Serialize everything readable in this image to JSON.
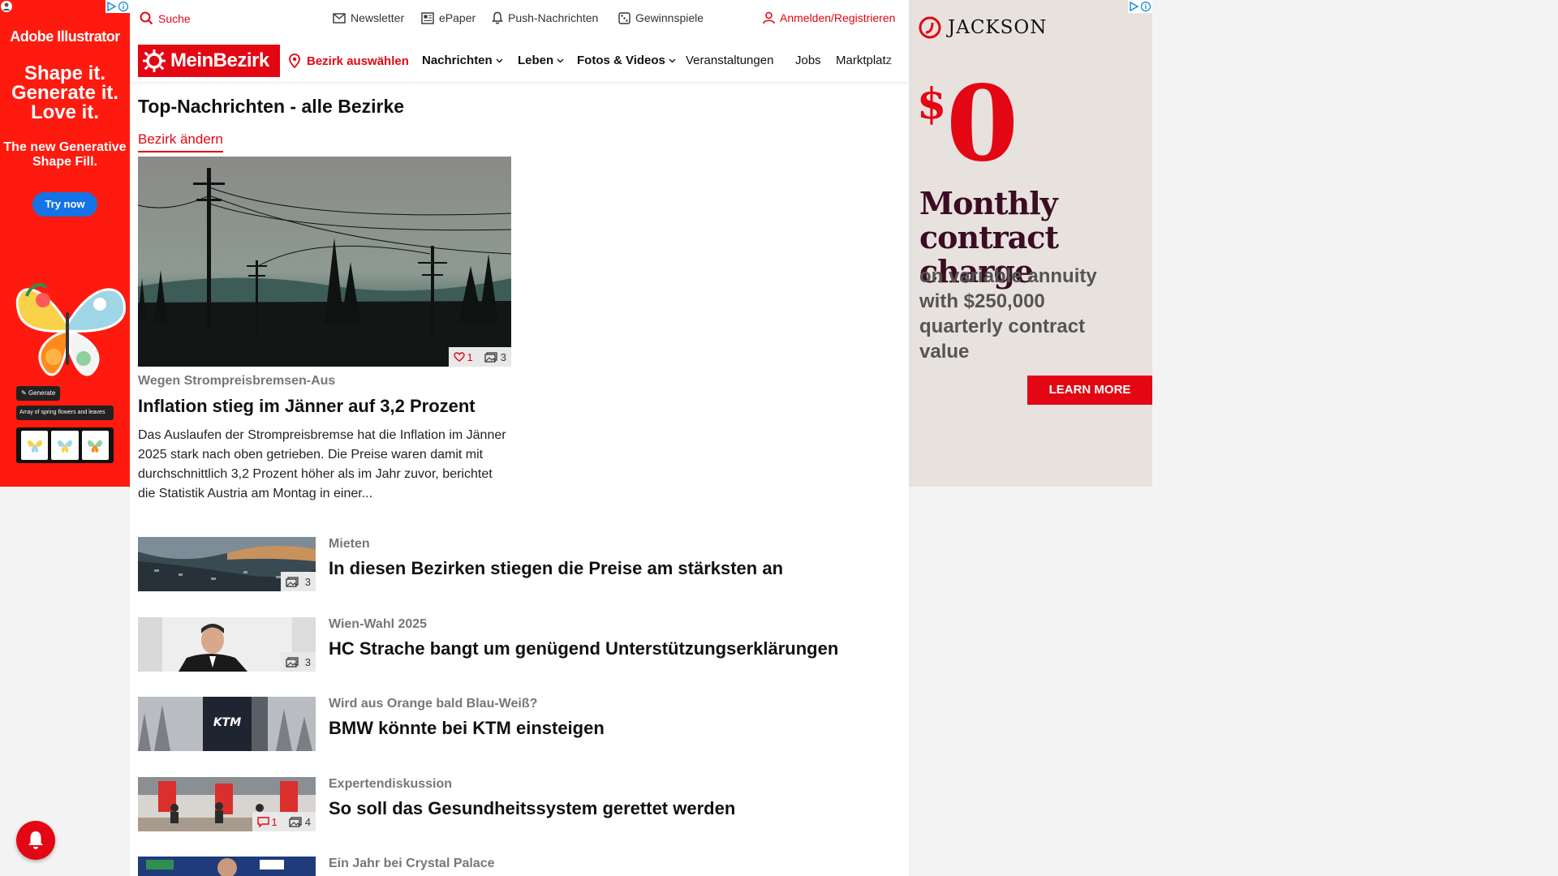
{
  "ad_left": {
    "brand": "Adobe Illustrator",
    "headline": "Shape it. Generate it. Love it.",
    "sub": "The new Generative Shape Fill.",
    "cta": "Try now",
    "generate_chip": "Generate",
    "prompt": "Array of spring flowers and leaves"
  },
  "topbar": {
    "search": "Suche",
    "newsletter": "Newsletter",
    "epaper": "ePaper",
    "push": "Push-Nachrichten",
    "gewinnspiele": "Gewinnspiele",
    "login": "Anmelden/Registrieren"
  },
  "nav": {
    "logo": "MeinBezirk",
    "region": "Bezirk auswählen",
    "items": [
      "Nachrichten",
      "Leben",
      "Fotos & Videos",
      "Veranstaltungen",
      "Jobs",
      "Marktplatz"
    ]
  },
  "page": {
    "title": "Top-Nachrichten - alle Bezirke",
    "region_link": "Bezirk ändern"
  },
  "hero": {
    "likes": "1",
    "photos": "3",
    "kicker": "Wegen Strompreisbremsen-Aus",
    "title": "Inflation stieg im Jänner auf 3,2 Prozent",
    "teaser": "Das Auslaufen der Strompreisbremse hat die Inflation im Jänner 2025 stark nach oben getrieben. Die Preise waren damit mit durchschnittlich 3,2 Prozent höher als im Jahr zuvor, berichtet die Statistik Austria am Montag in einer..."
  },
  "articles": [
    {
      "kicker": "Mieten",
      "title": "In diesen Bezirken stiegen die Preise am stärksten an",
      "photos": "3",
      "comments": ""
    },
    {
      "kicker": "Wien-Wahl 2025",
      "title": "HC Strache bangt um genügend Unterstützungserklärungen",
      "photos": "3",
      "comments": ""
    },
    {
      "kicker": "Wird aus Orange bald Blau-Weiß?",
      "title": "BMW könnte bei KTM einsteigen",
      "photos": "",
      "comments": ""
    },
    {
      "kicker": "Expertendiskussion",
      "title": "So soll das Gesundheitssystem gerettet werden",
      "photos": "4",
      "comments": "1"
    },
    {
      "kicker": "Ein Jahr bei Crystal Palace",
      "title": "",
      "photos": "",
      "comments": ""
    }
  ],
  "ad_right": {
    "brand": "JACKSON",
    "dollar": "$",
    "amount": "0",
    "offer": "Monthly contract charge",
    "detail": "on variable annuity with $250,000 quarterly contract value",
    "cta": "LEARN MORE"
  },
  "colors": {
    "brand_red": "#e30613",
    "adobe_red": "#ff1a0f",
    "jackson_plum": "#3a0d22"
  }
}
